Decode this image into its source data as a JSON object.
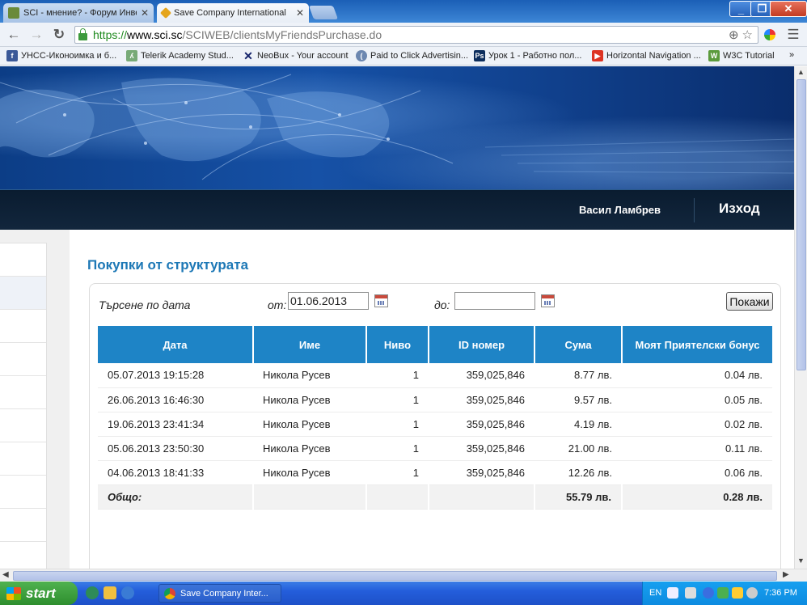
{
  "browser": {
    "tabs": [
      {
        "title": "SCI - мнение? - Форум Инве",
        "active": false
      },
      {
        "title": "Save Company International",
        "active": true
      }
    ],
    "url": {
      "scheme": "https://",
      "host": "www.sci.sc",
      "path": "/SCIWEB/clientsMyFriendsPurchase.do"
    },
    "bookmarks": [
      "УНСС-Иконоимка и б...",
      "Telerik Academy Stud...",
      "NeoBux - Your account",
      "Paid to Click Advertisin...",
      "Урок 1 - Работно пол...",
      "Horizontal Navigation ...",
      "W3C Tutorial"
    ],
    "bookmarks_overflow": "»"
  },
  "header": {
    "user_name": "Васил Ламбрев",
    "logout_label": "Изход"
  },
  "page": {
    "title": "Покупки от структурата",
    "search": {
      "label": "Търсене по дата",
      "from_label": "от:",
      "from_value": "01.06.2013",
      "to_label": "до:",
      "to_value": "",
      "show_button": "Покажи"
    },
    "table": {
      "columns": [
        "Дата",
        "Име",
        "Ниво",
        "ID номер",
        "Сума",
        "Моят Приятелски бонус"
      ],
      "rows": [
        {
          "date": "05.07.2013 19:15:28",
          "name": "Никола Русев",
          "level": "1",
          "id": "359,025,846",
          "amount": "8.77 лв.",
          "bonus": "0.04 лв."
        },
        {
          "date": "26.06.2013 16:46:30",
          "name": "Никола Русев",
          "level": "1",
          "id": "359,025,846",
          "amount": "9.57 лв.",
          "bonus": "0.05 лв."
        },
        {
          "date": "19.06.2013 23:41:34",
          "name": "Никола Русев",
          "level": "1",
          "id": "359,025,846",
          "amount": "4.19 лв.",
          "bonus": "0.02 лв."
        },
        {
          "date": "05.06.2013 23:50:30",
          "name": "Никола Русев",
          "level": "1",
          "id": "359,025,846",
          "amount": "21.00 лв.",
          "bonus": "0.11 лв."
        },
        {
          "date": "04.06.2013 18:41:33",
          "name": "Никола Русев",
          "level": "1",
          "id": "359,025,846",
          "amount": "12.26 лв.",
          "bonus": "0.06 лв."
        }
      ],
      "total": {
        "label": "Общо:",
        "amount": "55.79 лв.",
        "bonus": "0.28 лв."
      }
    }
  },
  "taskbar": {
    "start_label": "start",
    "task_title": "Save Company Inter...",
    "language": "EN",
    "clock": "7:36 PM"
  },
  "colors": {
    "table_header": "#1e84c6",
    "page_title": "#1d78b6",
    "userbar": "#0a1c30"
  }
}
